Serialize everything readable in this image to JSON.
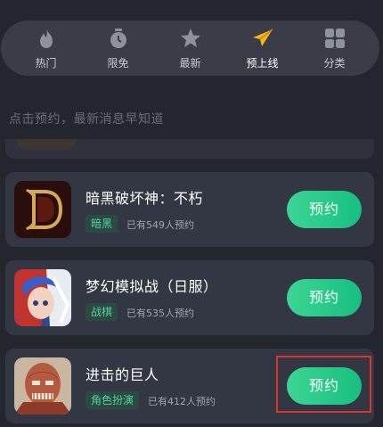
{
  "tabs": [
    {
      "label": "热门",
      "icon": "flame-icon"
    },
    {
      "label": "限免",
      "icon": "stopwatch-icon"
    },
    {
      "label": "最新",
      "icon": "star-icon"
    },
    {
      "label": "预上线",
      "icon": "paper-plane-icon",
      "active": true
    },
    {
      "label": "分类",
      "icon": "grid-icon"
    }
  ],
  "hint": "点击预约，最新消息早知道",
  "games": [
    {
      "title": "暗黑破坏神：不朽",
      "tag": "暗黑",
      "count": "已有549人预约",
      "button": "预约",
      "icon": "diablo-icon"
    },
    {
      "title": "梦幻模拟战（日服）",
      "tag": "战棋",
      "count": "已有535人预约",
      "button": "预约",
      "icon": "langrisser-icon"
    },
    {
      "title": "进击的巨人",
      "tag": "角色扮演",
      "count": "已有412人预约",
      "button": "预约",
      "icon": "titan-icon"
    }
  ],
  "colors": {
    "accent": "#22c985",
    "highlight": "#e0332d",
    "background": "#23262f",
    "card": "#333643"
  }
}
